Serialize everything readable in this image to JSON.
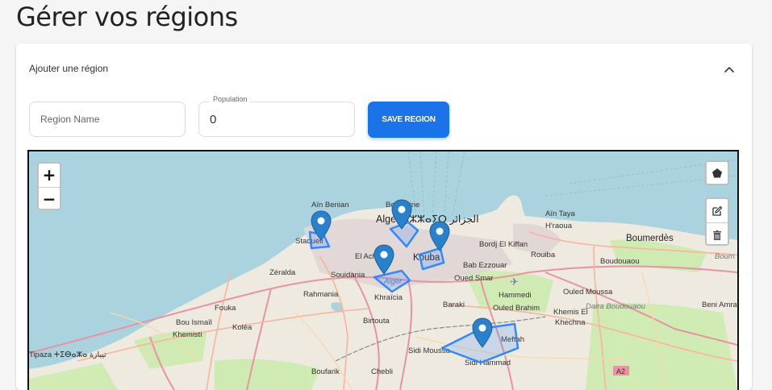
{
  "page": {
    "title": "Gérer vos régions"
  },
  "panel": {
    "title": "Ajouter une région",
    "expanded": true
  },
  "form": {
    "name_placeholder": "Region Name",
    "name_value": "",
    "population_label": "Population",
    "population_value": "0",
    "save_label": "SAVE REGION"
  },
  "map": {
    "zoom_in": "+",
    "zoom_out": "−",
    "draw_tool_icon": "pentagon-icon",
    "edit_tool_icon": "edit-icon",
    "delete_tool_icon": "trash-icon",
    "marker_color": "#2a81cb",
    "polygon_color": "#3388ff",
    "place_labels": [
      "Aïn Benian",
      "Bologhine",
      "Alger ⴷⵣⵣⴰⵢⵔ الجزائر",
      "Staoueli",
      "El Achour",
      "Kouba",
      "Bordj El Kiffan",
      "Aïn Taya",
      "H'raoua",
      "Boumerdès",
      "Rouiba",
      "Bab Ezzouar",
      "Oued Smar",
      "Boudouaou",
      "Zéralda",
      "Souidania",
      "Alger",
      "Rahmania",
      "Khraïcia",
      "Baraki",
      "Hammedi",
      "Ouled Moussa",
      "Ouled Brahim",
      "Khemis El",
      "Khechna",
      "Dalra Boudouaou",
      "Beni Amra",
      "Fouka",
      "Bou Ismaïl",
      "Koléa",
      "Khemisti",
      "Birtouta",
      "Sidi Moussa",
      "Meftah",
      "Sidi Hammad",
      "Tipaza ⵜⵉⴱⴰⵣⴰ تيبازة",
      "Boufarik",
      "Chebli",
      "A2",
      "Boum"
    ],
    "markers_count": 5,
    "polygons_count": 5
  }
}
